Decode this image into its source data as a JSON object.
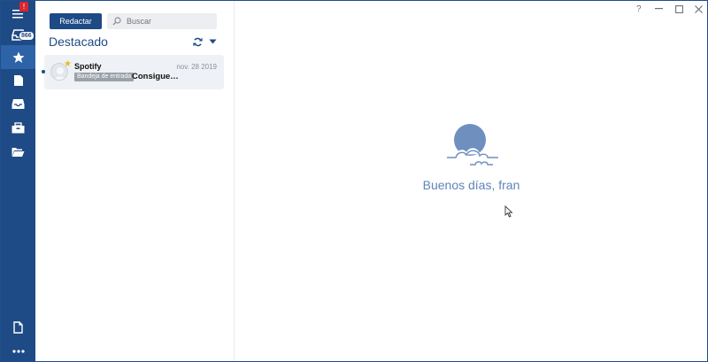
{
  "rail": {
    "notification_badge": "!",
    "inbox_count": "866"
  },
  "list": {
    "compose_label": "Redactar",
    "search_placeholder": "Buscar",
    "folder_title": "Destacado",
    "messages": [
      {
        "sender": "Spotify",
        "date": "nov. 28 2019",
        "folder_tag": "Bandeja de entrada",
        "subject": "Consigue…"
      }
    ]
  },
  "window": {
    "help_label": "?"
  },
  "reading": {
    "greeting": "Buenos días, fran"
  },
  "colors": {
    "rail_bg": "#1e4a85",
    "rail_active": "#2e63a8",
    "accent": "#1e4a85",
    "greeting": "#5f84b6",
    "star": "#e8b923",
    "badge": "#d9262f"
  }
}
